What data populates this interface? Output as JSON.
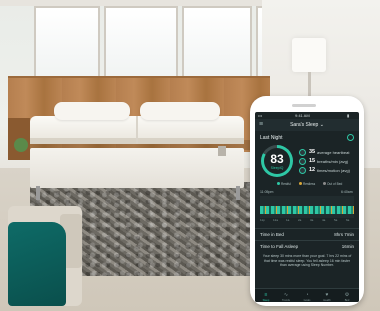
{
  "app": {
    "title": "Sara's Sleep",
    "title_arrow": "⌄",
    "header_left": "Last Night",
    "status_time": "9:41 AM",
    "accent": "#2ec7a5",
    "background": "#1b2426"
  },
  "score": {
    "value": "83",
    "label": "SleepIQ",
    "fill_fraction": 0.83
  },
  "stats": [
    {
      "num": "35",
      "label": "average heartbeat"
    },
    {
      "num": "15",
      "label": "breaths/min (avg)"
    },
    {
      "num": "12",
      "label": "times/motion (avg)"
    }
  ],
  "legend": [
    {
      "label": "Restful",
      "color": "#2ec7a5"
    },
    {
      "label": "Restless",
      "color": "#d6a63a"
    },
    {
      "label": "Out of Bed",
      "color": "#8b8b8b"
    }
  ],
  "graph": {
    "start_label": "11:05pm",
    "end_label": "6:40am",
    "axis": [
      "11p",
      "12a",
      "1a",
      "2a",
      "3a",
      "4a",
      "5a",
      "6a"
    ]
  },
  "rows": [
    {
      "key": "Time in Bed",
      "value": "8hrs 7min"
    },
    {
      "key": "Time to Fall Asleep",
      "value": "16min"
    }
  ],
  "summary": "Your sleep 30 mins more than your goal. 7 hrs 22 mins of that time was restful sleep. You fell asleep 16 min faster than average using Sleep Number.",
  "tabs": [
    {
      "icon": "≡",
      "label": "Sleep",
      "active": true
    },
    {
      "icon": "∿",
      "label": "Trends",
      "active": false
    },
    {
      "icon": "◔",
      "label": "Goals",
      "active": false
    },
    {
      "icon": "♥",
      "label": "Health",
      "active": false
    },
    {
      "icon": "⚙",
      "label": "Bed",
      "active": false
    }
  ]
}
